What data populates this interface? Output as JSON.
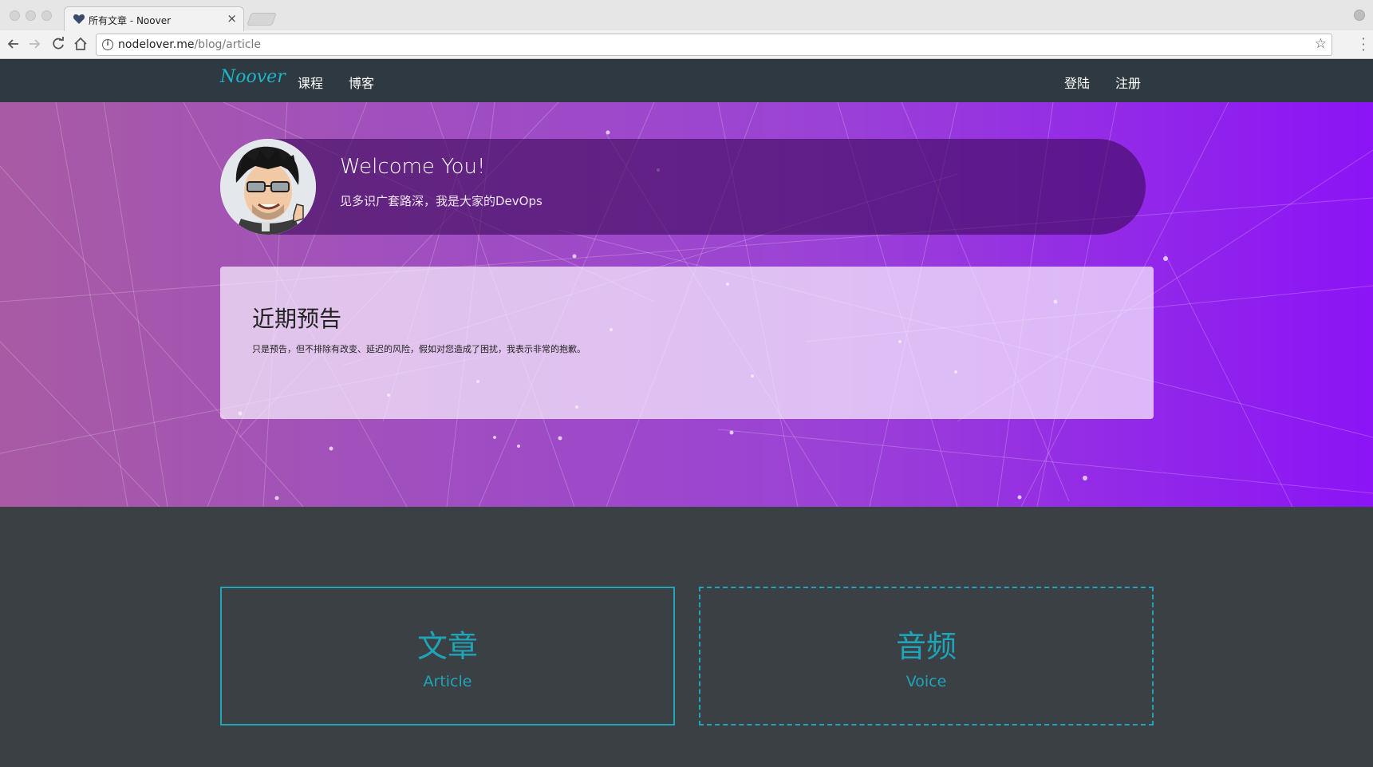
{
  "browser": {
    "tab_title": "所有文章 - Noover",
    "tab_close": "×",
    "url_host": "nodelover.me",
    "url_path": "/blog/article",
    "icons": [
      "back-arrow-icon",
      "forward-arrow-icon",
      "reload-icon",
      "home-icon",
      "info-icon",
      "star-icon",
      "menu-icon"
    ]
  },
  "navbar": {
    "brand": "Noover",
    "links": [
      "课程",
      "博客"
    ],
    "login": "登陆",
    "register": "注册"
  },
  "hero": {
    "welcome_title": "Welcome You!",
    "welcome_subtitle": "见多识广套路深，我是大家的DevOps",
    "notice_title": "近期预告",
    "notice_text": "只是预告，但不排除有改变、延迟的风险，假如对您造成了困扰，我表示非常的抱歉。"
  },
  "cards": [
    {
      "title": "文章",
      "subtitle": "Article"
    },
    {
      "title": "音频",
      "subtitle": "Voice"
    }
  ],
  "colors": {
    "navbar_bg": "#2e3941",
    "accent": "#1fa4b8",
    "page_bg": "#3a4043",
    "hero_start": "#a85ba3",
    "hero_end": "#8c14f6"
  }
}
